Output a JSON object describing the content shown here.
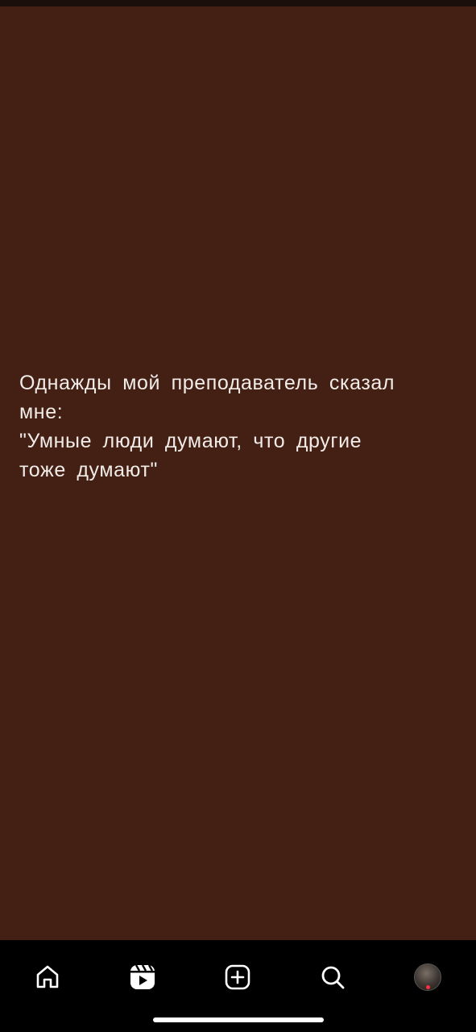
{
  "story": {
    "background_color": "#431f14",
    "text": "Однажды мой преподаватель сказал\nмне:\n\"Умные люди думают, что другие\nтоже думают\""
  },
  "nav": {
    "items": [
      {
        "name": "home",
        "icon": "home-icon"
      },
      {
        "name": "reels",
        "icon": "reels-icon"
      },
      {
        "name": "create",
        "icon": "plus-square-icon"
      },
      {
        "name": "search",
        "icon": "search-icon"
      },
      {
        "name": "profile",
        "icon": "avatar"
      }
    ],
    "notification_color": "#ff3040"
  }
}
